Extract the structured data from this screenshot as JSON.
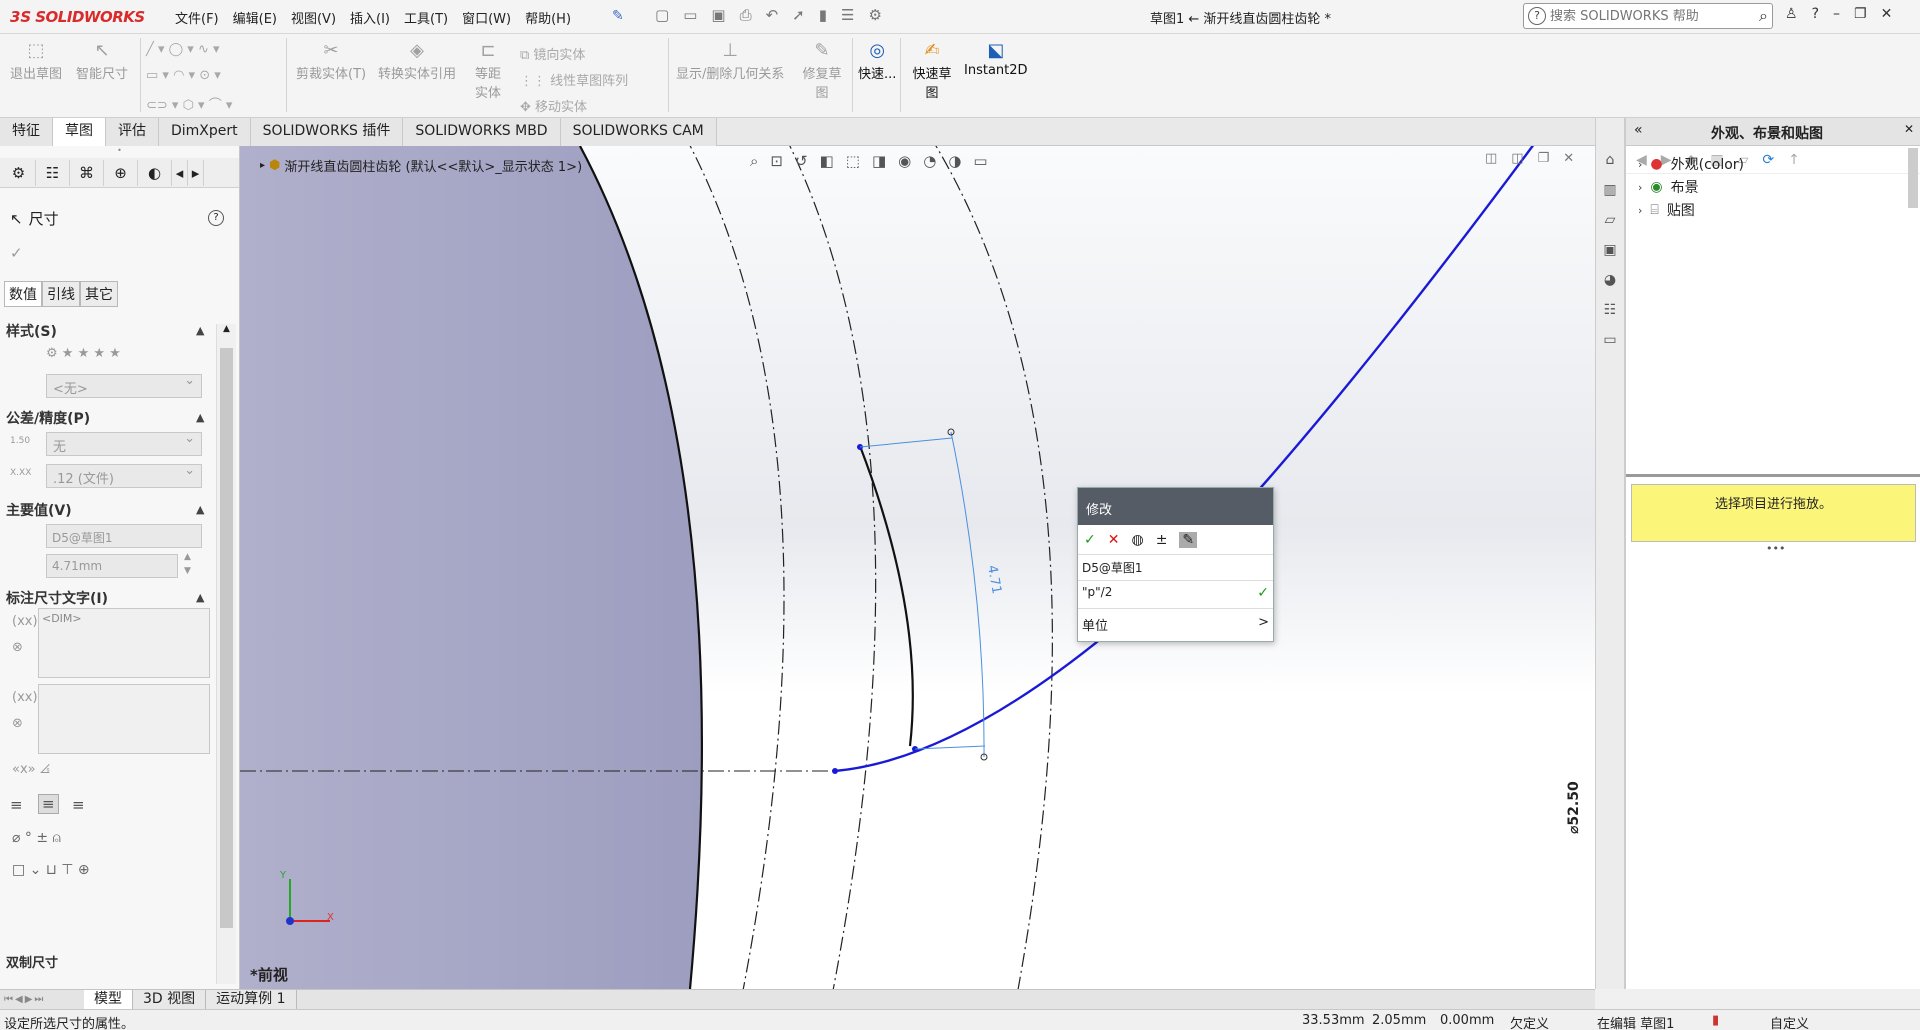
{
  "app": {
    "logo_ds": "3S",
    "logo_name": "SOLIDWORKS",
    "document_title": "草图1 ← 渐开线直齿圆柱齿轮 *"
  },
  "menu": [
    "文件(F)",
    "编辑(E)",
    "视图(V)",
    "插入(I)",
    "工具(T)",
    "窗口(W)",
    "帮助(H)"
  ],
  "search": {
    "placeholder": "搜索 SOLIDWORKS 帮助"
  },
  "commands": {
    "exit_sketch": "退出草图",
    "smart_dim": "智能尺寸",
    "trim": "剪裁实体(T)",
    "convert": "转换实体引用",
    "offset": "等距实体",
    "mirror": "镜向实体",
    "linear_pattern": "线性草图阵列",
    "move": "移动实体",
    "show_hide_relations": "显示/删除几何关系",
    "repair": "修复草图",
    "quick_snap": "快速...",
    "quick_sketch": "快速草图",
    "instant2d": "Instant2D"
  },
  "tabs": [
    "特征",
    "草图",
    "评估",
    "DimXpert",
    "SOLIDWORKS 插件",
    "SOLIDWORKS MBD",
    "SOLIDWORKS CAM"
  ],
  "active_tab_index": 1,
  "left_panel": {
    "title": "尺寸",
    "subtabs": [
      "数值",
      "引线",
      "其它"
    ],
    "style_section": "样式(S)",
    "style_value": "<无>",
    "tolerance_section": "公差/精度(P)",
    "tolerance_value": "无",
    "precision_value": ".12 (文件)",
    "primary_section": "主要值(V)",
    "primary_name": "D5@草图1",
    "primary_value": "4.71mm",
    "dimtext_section": "标注尺寸文字(I)",
    "dimtext_value": "<DIM>",
    "bottom_section": "双制尺寸"
  },
  "graphics": {
    "tree_label": "渐开线直齿圆柱齿轮  (默认<<默认>_显示状态 1>)",
    "view_label": "*前视",
    "diameter_label": "⌀52.50",
    "dim_value": "4.71"
  },
  "modify_dialog": {
    "title": "修改",
    "dim_name": "D5@草图1",
    "expression": "\"p\"/2",
    "unit_label": "单位",
    "unit_arrow": ">"
  },
  "task_pane": {
    "title": "外观、布景和贴图",
    "items": [
      "外观(color)",
      "布景",
      "贴图"
    ],
    "message": "选择项目进行拖放。"
  },
  "bottom_tabs": [
    "模型",
    "3D 视图",
    "运动算例 1"
  ],
  "status": {
    "hint": "设定所选尺寸的属性。",
    "x": "33.53mm",
    "y": "2.05mm",
    "z": "0.00mm",
    "define_state": "欠定义",
    "edit_state": "在编辑 草图1",
    "custom": "自定义"
  },
  "colors": {
    "curve_blue": "#1a1ad6",
    "gear_body": "#a8a8c8",
    "dialog_header": "#555c66",
    "message_bg": "#fbf57a"
  }
}
